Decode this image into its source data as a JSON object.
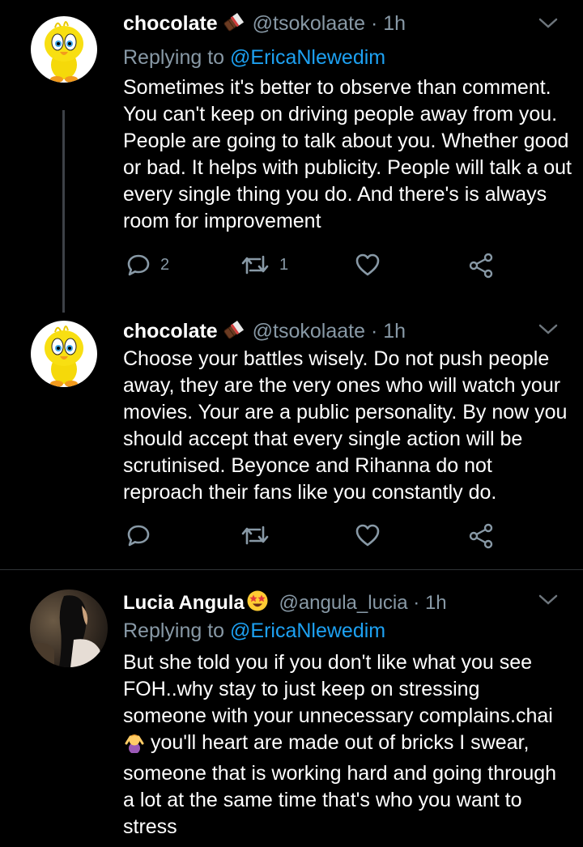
{
  "tweets": [
    {
      "name": "chocolate",
      "name_emoji": "chocolate-bar-emoji",
      "handle": "@tsokolaate",
      "separator": "·",
      "time": "1h",
      "replying_prefix": "Replying to",
      "replying_to": "@EricaNlewedim",
      "text": "Sometimes it's better to observe than comment. You can't keep on driving people away from you. People are going to talk about you. Whether good or bad. It helps with publicity. People will talk a out every single thing you do. And there's is always room for improvement",
      "reply_count": "2",
      "retweet_count": "1"
    },
    {
      "name": "chocolate",
      "name_emoji": "chocolate-bar-emoji",
      "handle": "@tsokolaate",
      "separator": "·",
      "time": "1h",
      "text": "Choose your battles wisely. Do not push people away, they are the very ones who will watch your movies. Your are a public personality. By now you should accept that every single action will be scrutinised. Beyonce and Rihanna do not reproach their fans like you constantly do."
    },
    {
      "name": "Lucia Angula",
      "name_emoji": "star-struck-emoji",
      "handle": "@angula_lucia",
      "separator": "·",
      "time": "1h",
      "replying_prefix": "Replying to",
      "replying_to": "@EricaNlewedim",
      "text_before_emoji": "But she told you if you don't like what you see FOH..why stay to just keep on stressing someone with your unnecessary complains.chai",
      "inline_emoji": "woman-gesturing-emoji",
      "text_after_emoji": " you'll heart are made out of bricks I swear, someone that is working hard and going through a lot at the same time that's who you want to stress"
    }
  ],
  "colors": {
    "background": "#000000",
    "secondary_text": "#8899a6",
    "link": "#1da1f2",
    "divider": "#2f3336"
  }
}
